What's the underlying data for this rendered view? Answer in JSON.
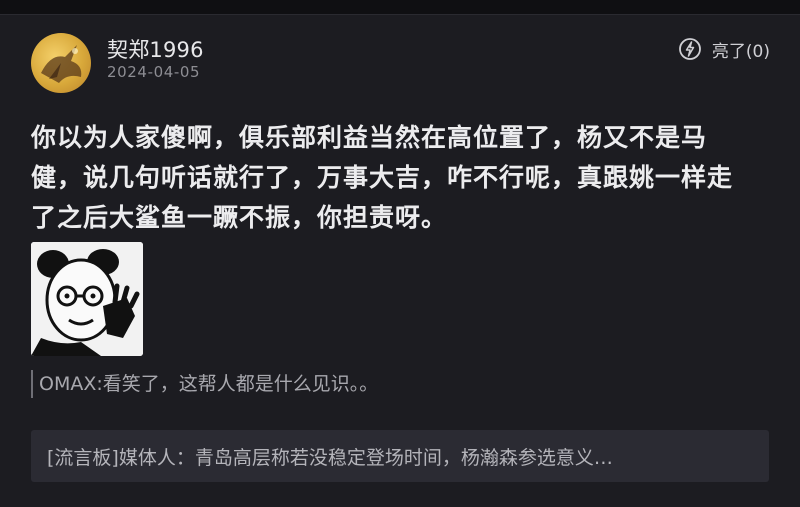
{
  "post": {
    "username": "契郑1996",
    "date": "2024-04-05",
    "like_label": "亮了(0)",
    "body_lines": [
      "你以为人家傻啊，俱乐部利益当然在高位置了，杨又不是马",
      "健，说几句听话就行了，万事大吉，咋不行呢，真跟姚一样走",
      "了之后大鲨鱼一蹶不振，你担责呀。"
    ],
    "quote": "OMAX:看笑了，这帮人都是什么见识。。",
    "recommendation": "[流言板]媒体人：青岛高层称若没稳定登场时间，杨瀚森参选意义…"
  },
  "icons": {
    "like": "lightbulb-icon",
    "avatar": "avatar-image",
    "meme": "meme-image"
  },
  "colors": {
    "background": "#1c1c21",
    "text_primary": "#ececee",
    "text_secondary": "#8d8d93",
    "card_bg": "#2b2b33"
  }
}
